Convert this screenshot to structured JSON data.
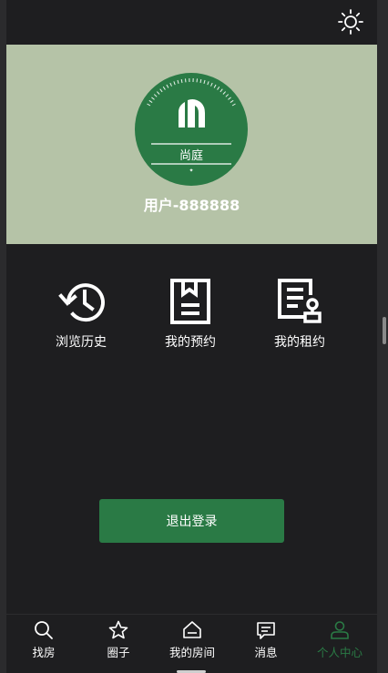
{
  "colors": {
    "accent": "#2a7a45",
    "profile_bg": "#b5c3a7",
    "page_bg": "#1e1e20",
    "text": "#ffffff"
  },
  "topbar": {
    "theme_icon": "sun-icon"
  },
  "profile": {
    "logo_text": "尚庭",
    "username": "用户-888888"
  },
  "shortcuts": [
    {
      "label": "浏览历史",
      "icon": "history-icon"
    },
    {
      "label": "我的预约",
      "icon": "bookmark-document-icon"
    },
    {
      "label": "我的租约",
      "icon": "contract-icon"
    }
  ],
  "logout": {
    "label": "退出登录"
  },
  "tabbar": {
    "active": "个人中心",
    "items": [
      {
        "label": "找房",
        "icon": "search-icon"
      },
      {
        "label": "圈子",
        "icon": "star-icon"
      },
      {
        "label": "我的房间",
        "icon": "home-icon"
      },
      {
        "label": "消息",
        "icon": "message-icon"
      },
      {
        "label": "个人中心",
        "icon": "user-icon"
      }
    ]
  }
}
